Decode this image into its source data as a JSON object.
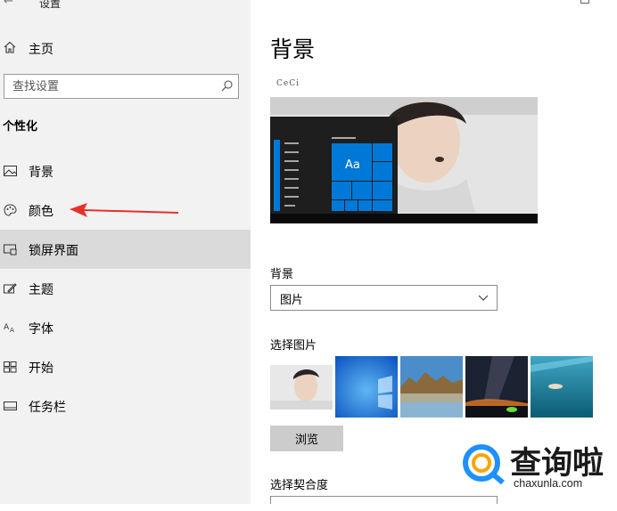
{
  "window": {
    "title": "设置",
    "back_icon": "back-arrow-icon"
  },
  "sidebar": {
    "home_label": "主页",
    "search": {
      "placeholder": "查找设置"
    },
    "section_title": "个性化",
    "items": [
      {
        "label": "背景",
        "icon": "picture-icon",
        "selected": false
      },
      {
        "label": "颜色",
        "icon": "palette-icon",
        "selected": false
      },
      {
        "label": "锁屏界面",
        "icon": "lock-screen-icon",
        "selected": true
      },
      {
        "label": "主题",
        "icon": "brush-icon",
        "selected": false
      },
      {
        "label": "字体",
        "icon": "font-icon",
        "selected": false
      },
      {
        "label": "开始",
        "icon": "start-icon",
        "selected": false
      },
      {
        "label": "任务栏",
        "icon": "taskbar-icon",
        "selected": false
      }
    ]
  },
  "main": {
    "title": "背景",
    "preview": {
      "sample_text": "Aa",
      "watermark": "CeCi"
    },
    "background_label": "背景",
    "background_value": "图片",
    "choose_picture_label": "选择图片",
    "browse_label": "浏览",
    "fit_label": "选择契合度"
  },
  "logo": {
    "text": "查询啦",
    "url": "chaxunla.com"
  },
  "colors": {
    "accent": "#0078d7",
    "annotation": "#e8302a",
    "sidebar_bg": "#f2f2f2",
    "selected_bg": "#dadada"
  }
}
